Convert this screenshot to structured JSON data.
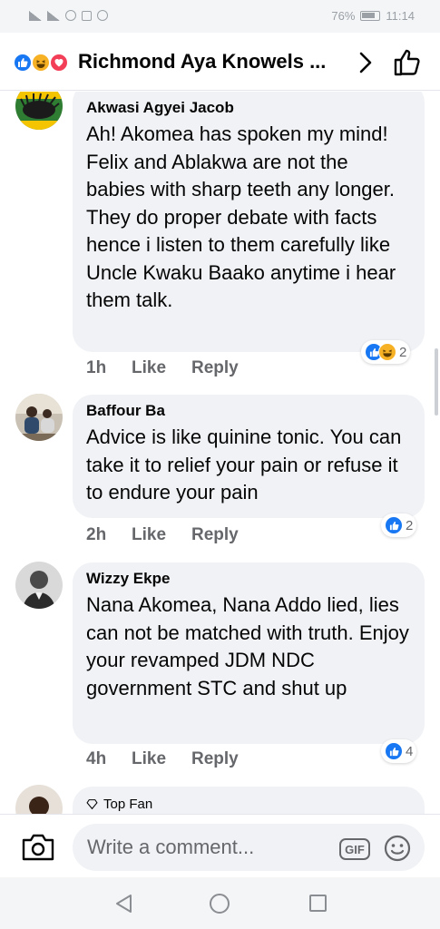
{
  "status_bar": {
    "battery": "76%",
    "time": "11:14"
  },
  "header": {
    "title": "Richmond Aya Knowels ...",
    "reaction_icons": [
      "like-icon",
      "haha-icon",
      "love-icon"
    ]
  },
  "comments": [
    {
      "author": "Akwasi Agyei Jacob",
      "text": "Ah! Akomea has spoken my mind! Felix and Ablakwa are not the babies with sharp teeth any longer. They do proper debate with facts hence i listen to them carefully like Uncle Kwaku Baako anytime i hear them talk.",
      "time": "1h",
      "like_label": "Like",
      "reply_label": "Reply",
      "reactions": [
        "like",
        "haha"
      ],
      "reaction_count": "2"
    },
    {
      "author": "Baffour Ba",
      "text": "Advice is like quinine tonic. You can take it to relief your pain or refuse it to endure your pain",
      "time": "2h",
      "like_label": "Like",
      "reply_label": "Reply",
      "reactions": [
        "like"
      ],
      "reaction_count": "2"
    },
    {
      "author": "Wizzy Ekpe",
      "text": "Nana Akomea, Nana Addo lied, lies can not be matched with truth. Enjoy your revamped JDM NDC government STC and shut up",
      "time": "4h",
      "like_label": "Like",
      "reply_label": "Reply",
      "reactions": [
        "like"
      ],
      "reaction_count": "4"
    },
    {
      "badge": "Top Fan"
    }
  ],
  "composer": {
    "placeholder": "Write a comment...",
    "gif_label": "GIF"
  },
  "colors": {
    "facebook_blue": "#1877f2",
    "bubble_gray": "#f0f2f5",
    "meta_gray": "#65676b",
    "haha_yellow": "#f7b125",
    "love_red": "#f33e58"
  }
}
